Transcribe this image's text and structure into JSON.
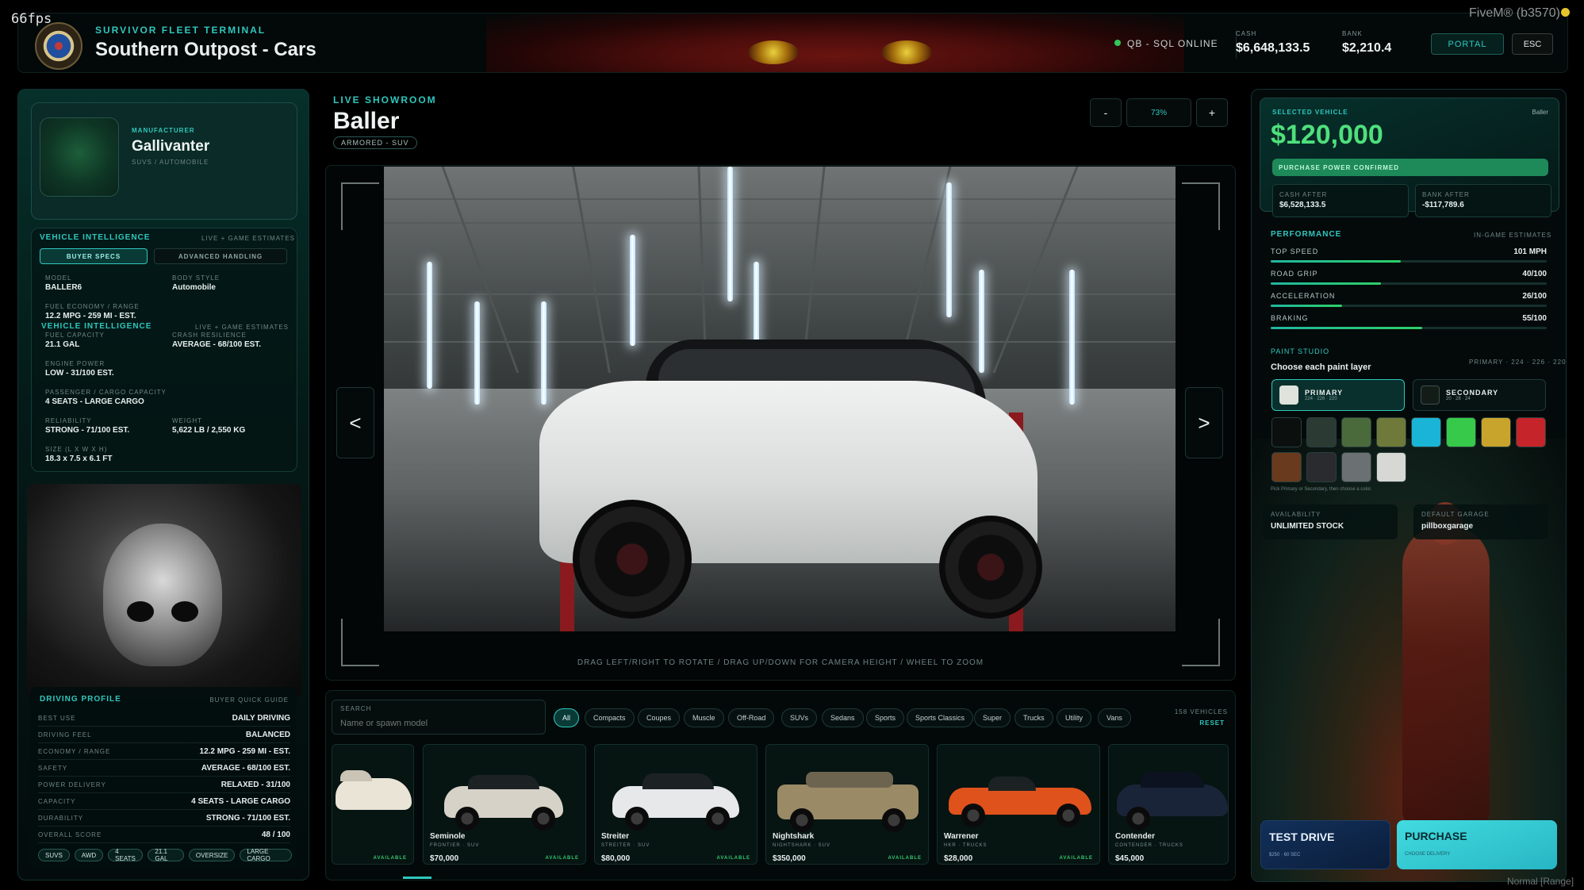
{
  "fps": "66fps",
  "fivem": "FiveM® (b3570)",
  "header": {
    "subtitle": "SURVIVOR FLEET TERMINAL",
    "title": "Southern Outpost - Cars",
    "sql_status": "QB - SQL ONLINE",
    "cash_label": "CASH",
    "cash_value": "$6,648,133.5",
    "bank_label": "BANK",
    "bank_value": "$2,210.4",
    "portal_label": "PORTAL",
    "esc_label": "ESC"
  },
  "manufacturer": {
    "label": "MANUFACTURER",
    "name": "Gallivanter",
    "sub": "SUVS / AUTOMOBILE"
  },
  "intel": {
    "title": "VEHICLE INTELLIGENCE",
    "note": "LIVE + GAME ESTIMATES",
    "tabs": [
      "BUYER SPECS",
      "ADVANCED HANDLING"
    ],
    "specs": [
      {
        "k": "MODEL",
        "v": "BALLER6"
      },
      {
        "k": "BODY STYLE",
        "v": "Automobile"
      },
      {
        "k": "FUEL ECONOMY / RANGE",
        "v": "12.2 MPG - 259 MI - EST."
      },
      {
        "k": "FUEL CAPACITY",
        "v": "21.1 GAL"
      },
      {
        "k": "CRASH RESILIENCE",
        "v": "AVERAGE - 68/100 EST."
      },
      {
        "k": "ENGINE POWER",
        "v": "LOW - 31/100 EST."
      },
      {
        "k": "PASSENGER / CARGO CAPACITY",
        "v": "4 SEATS - LARGE CARGO"
      },
      {
        "k": "RELIABILITY",
        "v": "STRONG - 71/100 EST."
      },
      {
        "k": "WEIGHT",
        "v": "5,622 LB / 2,550 KG"
      },
      {
        "k": "SIZE (L x W x H)",
        "v": "18.3 x 7.5 x 6.1 FT"
      }
    ]
  },
  "profile": {
    "title": "DRIVING PROFILE",
    "note": "BUYER QUICK GUIDE",
    "rows": [
      {
        "k": "BEST USE",
        "v": "DAILY DRIVING"
      },
      {
        "k": "DRIVING FEEL",
        "v": "BALANCED"
      },
      {
        "k": "ECONOMY / RANGE",
        "v": "12.2 MPG - 259 MI - EST."
      },
      {
        "k": "SAFETY",
        "v": "AVERAGE - 68/100 EST."
      },
      {
        "k": "POWER DELIVERY",
        "v": "RELAXED - 31/100"
      },
      {
        "k": "CAPACITY",
        "v": "4 SEATS - LARGE CARGO"
      },
      {
        "k": "DURABILITY",
        "v": "STRONG - 71/100 EST."
      },
      {
        "k": "OVERALL SCORE",
        "v": "48 / 100"
      }
    ],
    "chips": [
      "SUVS",
      "AWD",
      "4 SEATS",
      "21.1 GAL",
      "OVERSIZE",
      "LARGE CARGO"
    ]
  },
  "showroom": {
    "label": "LIVE SHOWROOM",
    "title": "Baller",
    "badge": "ARMORED - SUV",
    "zoom_minus": "-",
    "zoom_value": "73%",
    "zoom_plus": "+",
    "prev": "<",
    "next": ">",
    "hint": "DRAG LEFT/RIGHT TO ROTATE / DRAG UP/DOWN FOR CAMERA HEIGHT / WHEEL TO ZOOM"
  },
  "browser": {
    "search_label": "SEARCH",
    "search_placeholder": "Name or spawn model",
    "categories": [
      "All",
      "Compacts",
      "Coupes",
      "Muscle",
      "Off-Road",
      "SUVs",
      "Sedans",
      "Sports",
      "Sports Classics",
      "Super",
      "Trucks",
      "Utility",
      "Vans"
    ],
    "count": "158 VEHICLES",
    "reset": "RESET",
    "cards": [
      {
        "name": "",
        "sub": "",
        "price": "",
        "status": "AVAILABLE",
        "color": "#e9e4d6"
      },
      {
        "name": "Seminole",
        "sub": "FRONTIER · SUV",
        "price": "$70,000",
        "status": "AVAILABLE",
        "color": "#d7d2c8"
      },
      {
        "name": "Streiter",
        "sub": "STREITER · SUV",
        "price": "$80,000",
        "status": "AVAILABLE",
        "color": "#e6e8ea"
      },
      {
        "name": "Nightshark",
        "sub": "NIGHTSHARK · SUV",
        "price": "$350,000",
        "status": "AVAILABLE",
        "color": "#9a8a66"
      },
      {
        "name": "Warrener",
        "sub": "HKR · TRUCKS",
        "price": "$28,000",
        "status": "AVAILABLE",
        "color": "#e0521c"
      },
      {
        "name": "Contender",
        "sub": "CONTENDER · TRUCKS",
        "price": "$45,000",
        "status": "",
        "color": "#1a2438"
      }
    ]
  },
  "selected": {
    "label": "SELECTED VEHICLE",
    "model": "Baller",
    "price": "$120,000",
    "power": "PURCHASE POWER CONFIRMED",
    "cash_after_label": "CASH AFTER",
    "cash_after": "$6,528,133.5",
    "bank_after_label": "BANK AFTER",
    "bank_after": "-$117,789.6"
  },
  "performance": {
    "title": "PERFORMANCE",
    "note": "IN-GAME ESTIMATES",
    "stats": [
      {
        "k": "TOP SPEED",
        "v": "101 MPH",
        "fraction": 0.47
      },
      {
        "k": "ROAD GRIP",
        "v": "40/100",
        "fraction": 0.4
      },
      {
        "k": "ACCELERATION",
        "v": "26/100",
        "fraction": 0.26
      },
      {
        "k": "BRAKING",
        "v": "55/100",
        "fraction": 0.55
      }
    ]
  },
  "paint": {
    "title": "PAINT STUDIO",
    "subtitle": "Choose each paint layer",
    "current": "PRIMARY · 224 · 226 · 220",
    "primary_label": "PRIMARY",
    "primary_value": "224 · 226 · 220",
    "primary_color": "#e0e2dc",
    "secondary_label": "SECONDARY",
    "secondary_value": "20 · 28 · 24",
    "secondary_color": "#141c18",
    "swatches": [
      "#0b0f0e",
      "#2b3a33",
      "#4a6a3b",
      "#6f7a3a",
      "#19b4d6",
      "#36c94a",
      "#c9a42c",
      "#c4242a",
      "#6a3a1e",
      "#2a2b2e",
      "#6b7072",
      "#d7d8d4"
    ],
    "hint": "Pick Primary or Secondary, then choose a color."
  },
  "availability": {
    "label": "AVAILABILITY",
    "value": "UNLIMITED STOCK"
  },
  "garage": {
    "label": "DEFAULT GARAGE",
    "value": "pillboxgarage"
  },
  "actions": {
    "test_label": "TEST DRIVE",
    "test_sub": "$250 · 60 SEC",
    "buy_label": "PURCHASE",
    "buy_sub": "CHOOSE DELIVERY"
  },
  "footer_mode": "Normal [Range]"
}
